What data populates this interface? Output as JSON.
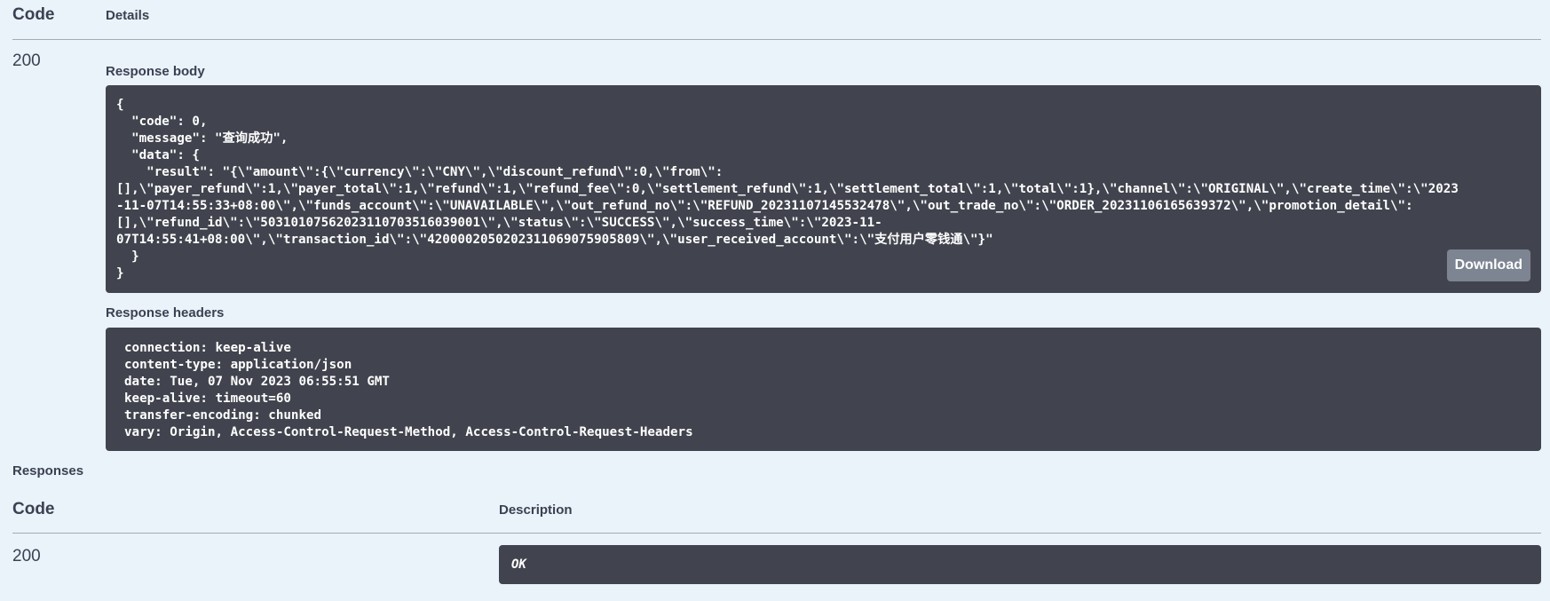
{
  "table_header": {
    "code": "Code",
    "details": "Details"
  },
  "response": {
    "status_code": "200",
    "body_label": "Response body",
    "body_lines": [
      "{",
      "  \"code\": 0,",
      "  \"message\": \"查询成功\",",
      "  \"data\": {",
      "    \"result\": \"{\\\"amount\\\":{\\\"currency\\\":\\\"CNY\\\",\\\"discount_refund\\\":0,\\\"from\\\":",
      "[],\\\"payer_refund\\\":1,\\\"payer_total\\\":1,\\\"refund\\\":1,\\\"refund_fee\\\":0,\\\"settlement_refund\\\":1,\\\"settlement_total\\\":1,\\\"total\\\":1},\\\"channel\\\":\\\"ORIGINAL\\\",\\\"create_time\\\":\\\"2023",
      "-11-07T14:55:33+08:00\\\",\\\"funds_account\\\":\\\"UNAVAILABLE\\\",\\\"out_refund_no\\\":\\\"REFUND_20231107145532478\\\",\\\"out_trade_no\\\":\\\"ORDER_20231106165639372\\\",\\\"promotion_detail\\\":",
      "[],\\\"refund_id\\\":\\\"50310107562023110703516039001\\\",\\\"status\\\":\\\"SUCCESS\\\",\\\"success_time\\\":\\\"2023-11-",
      "07T14:55:41+08:00\\\",\\\"transaction_id\\\":\\\"4200002050202311069075905809\\\",\\\"user_received_account\\\":\\\"支付用户零钱通\\\"}\"",
      "  }",
      "}"
    ],
    "download_label": "Download",
    "headers_label": "Response headers",
    "header_lines": [
      "connection: keep-alive",
      "content-type: application/json",
      "date: Tue, 07 Nov 2023 06:55:51 GMT",
      "keep-alive: timeout=60",
      "transfer-encoding: chunked",
      "vary: Origin, Access-Control-Request-Method, Access-Control-Request-Headers"
    ]
  },
  "responses_section": {
    "title": "Responses",
    "col_code": "Code",
    "col_description": "Description",
    "rows": [
      {
        "code": "200",
        "description": "OK"
      }
    ]
  }
}
